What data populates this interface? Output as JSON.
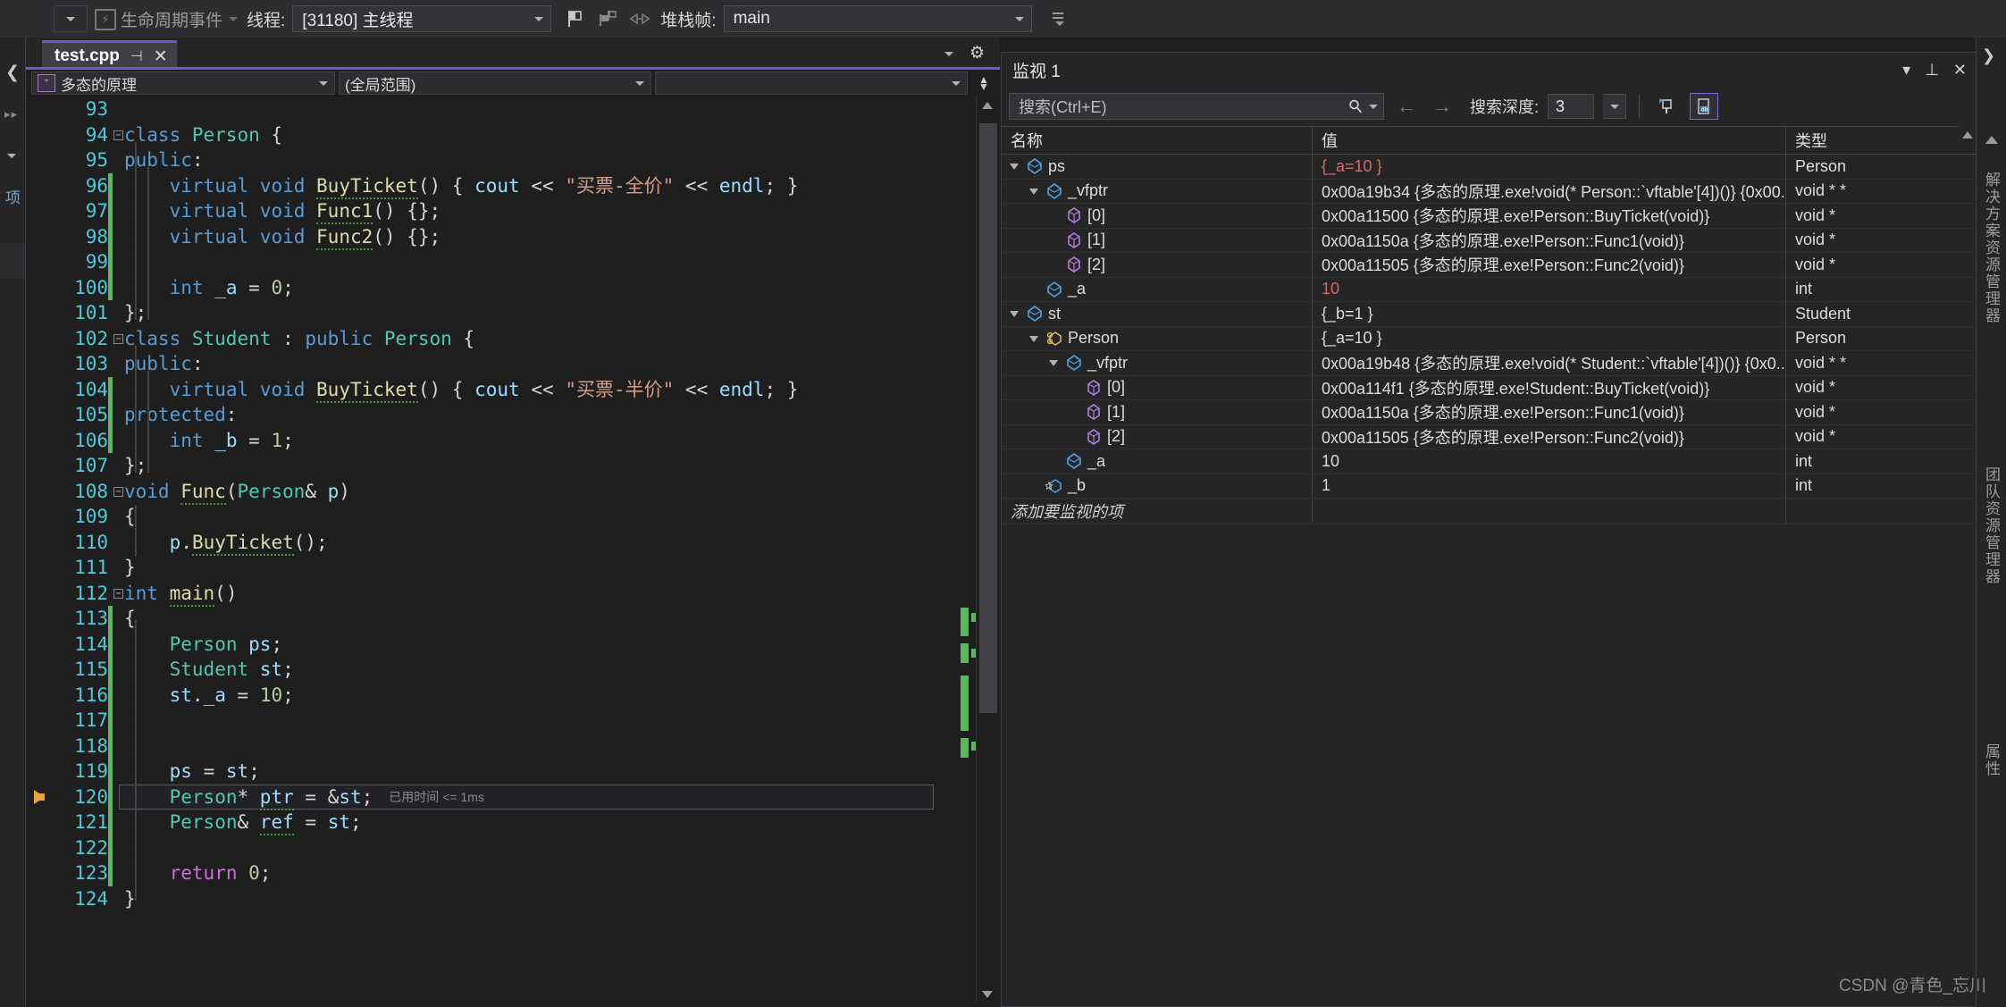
{
  "toolbar": {
    "lifecycle_label": "生命周期事件",
    "thread_label": "线程:",
    "thread_value": "[31180] 主线程",
    "frame_label": "堆栈帧:",
    "frame_value": "main",
    "icons": [
      "lifecycle-icon",
      "flag-icon",
      "flag-multi-icon",
      "link-icon"
    ]
  },
  "left_strip": {
    "vertical_label": "项"
  },
  "editor": {
    "tab": {
      "title": "test.cpp",
      "pin": "⊣",
      "close": "✕"
    },
    "settings_icon": "gear-icon",
    "crumbs": [
      {
        "label": "多态的原理",
        "icon": "cpp-project-icon"
      },
      {
        "label": "(全局范围)",
        "icon": ""
      },
      {
        "label": "",
        "icon": ""
      }
    ],
    "current_line": 120,
    "elapsed_note": "已用时间 <= 1ms",
    "lines": [
      {
        "n": 93,
        "text": ""
      },
      {
        "n": 94,
        "text": "class Person {"
      },
      {
        "n": 95,
        "text": "public:"
      },
      {
        "n": 96,
        "text": "    virtual void BuyTicket() { cout << \"买票-全价\" << endl; }"
      },
      {
        "n": 97,
        "text": "    virtual void Func1() {};"
      },
      {
        "n": 98,
        "text": "    virtual void Func2() {};"
      },
      {
        "n": 99,
        "text": ""
      },
      {
        "n": 100,
        "text": "    int _a = 0;"
      },
      {
        "n": 101,
        "text": "};"
      },
      {
        "n": 102,
        "text": "class Student : public Person {"
      },
      {
        "n": 103,
        "text": "public:"
      },
      {
        "n": 104,
        "text": "    virtual void BuyTicket() { cout << \"买票-半价\" << endl; }"
      },
      {
        "n": 105,
        "text": "protected:"
      },
      {
        "n": 106,
        "text": "    int _b = 1;"
      },
      {
        "n": 107,
        "text": "};"
      },
      {
        "n": 108,
        "text": "void Func(Person& p)"
      },
      {
        "n": 109,
        "text": "{"
      },
      {
        "n": 110,
        "text": "    p.BuyTicket();"
      },
      {
        "n": 111,
        "text": "}"
      },
      {
        "n": 112,
        "text": "int main()"
      },
      {
        "n": 113,
        "text": "{"
      },
      {
        "n": 114,
        "text": "    Person ps;"
      },
      {
        "n": 115,
        "text": "    Student st;"
      },
      {
        "n": 116,
        "text": "    st._a = 10;"
      },
      {
        "n": 117,
        "text": ""
      },
      {
        "n": 118,
        "text": ""
      },
      {
        "n": 119,
        "text": "    ps = st;"
      },
      {
        "n": 120,
        "text": "    Person* ptr = &st;"
      },
      {
        "n": 121,
        "text": "    Person& ref = st;"
      },
      {
        "n": 122,
        "text": ""
      },
      {
        "n": 123,
        "text": "    return 0;"
      },
      {
        "n": 124,
        "text": "}"
      }
    ]
  },
  "watch": {
    "title": "监视 1",
    "head_icons": [
      "chevron-down-icon",
      "pin-icon",
      "close-icon"
    ],
    "search_placeholder": "搜索(Ctrl+E)",
    "search_icon": "search-icon",
    "nav_back": "←",
    "nav_forward": "→",
    "depth_label": "搜索深度:",
    "depth_value": "3",
    "tool_icons": [
      "pin-column-icon",
      "hex-display-icon"
    ],
    "columns": [
      "名称",
      "值",
      "类型"
    ],
    "add_placeholder": "添加要监视的项",
    "rows": [
      {
        "depth": 0,
        "expander": "open",
        "icon": "struct-icon",
        "name": "ps",
        "value": "{_a=10 }",
        "type": "Person",
        "changed": true
      },
      {
        "depth": 1,
        "expander": "open",
        "icon": "struct-icon",
        "name": "_vfptr",
        "value": "0x00a19b34 {多态的原理.exe!void(* Person::`vftable'[4])()} {0x00...",
        "type": "void * *",
        "changed": false
      },
      {
        "depth": 2,
        "expander": "none",
        "icon": "element-icon",
        "name": "[0]",
        "value": "0x00a11500 {多态的原理.exe!Person::BuyTicket(void)}",
        "type": "void *",
        "changed": false
      },
      {
        "depth": 2,
        "expander": "none",
        "icon": "element-icon",
        "name": "[1]",
        "value": "0x00a1150a {多态的原理.exe!Person::Func1(void)}",
        "type": "void *",
        "changed": false
      },
      {
        "depth": 2,
        "expander": "none",
        "icon": "element-icon",
        "name": "[2]",
        "value": "0x00a11505 {多态的原理.exe!Person::Func2(void)}",
        "type": "void *",
        "changed": false
      },
      {
        "depth": 1,
        "expander": "none",
        "icon": "field-icon",
        "name": "_a",
        "value": "10",
        "type": "int",
        "changed": true
      },
      {
        "depth": 0,
        "expander": "open",
        "icon": "struct-icon",
        "name": "st",
        "value": "{_b=1 }",
        "type": "Student",
        "changed": false
      },
      {
        "depth": 1,
        "expander": "open",
        "icon": "base-class-icon",
        "name": "Person",
        "value": "{_a=10 }",
        "type": "Person",
        "changed": false
      },
      {
        "depth": 2,
        "expander": "open",
        "icon": "struct-icon",
        "name": "_vfptr",
        "value": "0x00a19b48 {多态的原理.exe!void(* Student::`vftable'[4])()} {0x0...",
        "type": "void * *",
        "changed": false
      },
      {
        "depth": 3,
        "expander": "none",
        "icon": "element-icon",
        "name": "[0]",
        "value": "0x00a114f1 {多态的原理.exe!Student::BuyTicket(void)}",
        "type": "void *",
        "changed": false
      },
      {
        "depth": 3,
        "expander": "none",
        "icon": "element-icon",
        "name": "[1]",
        "value": "0x00a1150a {多态的原理.exe!Person::Func1(void)}",
        "type": "void *",
        "changed": false
      },
      {
        "depth": 3,
        "expander": "none",
        "icon": "element-icon",
        "name": "[2]",
        "value": "0x00a11505 {多态的原理.exe!Person::Func2(void)}",
        "type": "void *",
        "changed": false
      },
      {
        "depth": 2,
        "expander": "none",
        "icon": "field-icon",
        "name": "_a",
        "value": "10",
        "type": "int",
        "changed": false
      },
      {
        "depth": 1,
        "expander": "none",
        "icon": "protected-field-icon",
        "name": "_b",
        "value": "1",
        "type": "int",
        "changed": false
      }
    ]
  },
  "right_strip": {
    "tabs": [
      "解决方案资源管理器",
      "团队资源管理器",
      "属性"
    ]
  },
  "watermark": "CSDN @青色_忘川"
}
